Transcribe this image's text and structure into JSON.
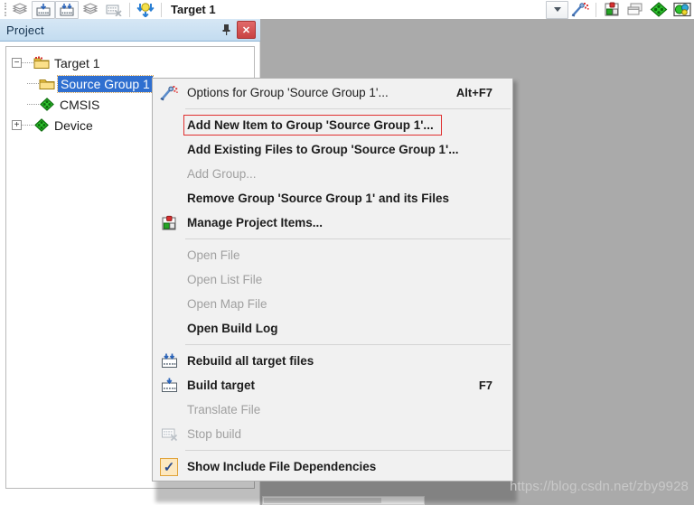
{
  "toolbar": {
    "icons": [
      {
        "name": "batch-build-icon",
        "glyph": "books"
      },
      {
        "name": "build-target-icon",
        "glyph": "build"
      },
      {
        "name": "rebuild-all-icon",
        "glyph": "rebuild"
      },
      {
        "name": "batch-setup-icon",
        "glyph": "books2"
      },
      {
        "name": "stop-build-icon",
        "glyph": "stopbuild"
      },
      {
        "name": "download-flash-icon",
        "glyph": "flash"
      }
    ],
    "target_label": "Target 1",
    "dropdown_arrow_name": "target-dropdown-arrow",
    "right_icons": [
      {
        "name": "target-options-icon",
        "glyph": "wand"
      },
      {
        "name": "manage-project-items-icon",
        "glyph": "cubes"
      },
      {
        "name": "multi-project-icon",
        "glyph": "windows"
      },
      {
        "name": "pack-installer-icon",
        "glyph": "greendiamond"
      },
      {
        "name": "manage-run-time-env-icon",
        "glyph": "globe"
      }
    ]
  },
  "project_panel": {
    "title": "Project",
    "pin_icon_name": "auto-hide-pin-icon",
    "close_label": "✕",
    "tree": [
      {
        "label": "Target 1",
        "icon": "target-folder-icon",
        "expander": "−",
        "level": 0,
        "selected": false
      },
      {
        "label": "Source Group 1",
        "icon": "folder-icon",
        "expander": "",
        "level": 1,
        "selected": true
      },
      {
        "label": "CMSIS",
        "icon": "component-icon",
        "expander": "",
        "level": 1,
        "selected": false
      },
      {
        "label": "Device",
        "icon": "component-icon",
        "expander": "+",
        "level": 1,
        "selected": false
      }
    ]
  },
  "context_menu": {
    "items": [
      {
        "kind": "item",
        "label": "Options for Group 'Source Group 1'...",
        "accel": "Alt+F7",
        "icon": "options-wand-icon",
        "disabled": false,
        "bold": false,
        "highlighted": false
      },
      {
        "kind": "separator"
      },
      {
        "kind": "item",
        "label": "Add New  Item to Group 'Source Group 1'...",
        "accel": "",
        "icon": "",
        "disabled": false,
        "bold": true,
        "highlighted": true
      },
      {
        "kind": "item",
        "label": "Add Existing Files to Group 'Source Group 1'...",
        "accel": "",
        "icon": "",
        "disabled": false,
        "bold": true,
        "highlighted": false
      },
      {
        "kind": "item",
        "label": "Add Group...",
        "accel": "",
        "icon": "",
        "disabled": true,
        "bold": false,
        "highlighted": false
      },
      {
        "kind": "item",
        "label": "Remove Group 'Source Group 1' and its Files",
        "accel": "",
        "icon": "",
        "disabled": false,
        "bold": true,
        "highlighted": false
      },
      {
        "kind": "item",
        "label": "Manage Project Items...",
        "accel": "",
        "icon": "manage-project-items-icon",
        "disabled": false,
        "bold": true,
        "highlighted": false
      },
      {
        "kind": "separator"
      },
      {
        "kind": "item",
        "label": "Open File",
        "accel": "",
        "icon": "",
        "disabled": true,
        "bold": false,
        "highlighted": false
      },
      {
        "kind": "item",
        "label": "Open List File",
        "accel": "",
        "icon": "",
        "disabled": true,
        "bold": false,
        "highlighted": false
      },
      {
        "kind": "item",
        "label": "Open Map File",
        "accel": "",
        "icon": "",
        "disabled": true,
        "bold": false,
        "highlighted": false
      },
      {
        "kind": "item",
        "label": "Open Build Log",
        "accel": "",
        "icon": "",
        "disabled": false,
        "bold": true,
        "highlighted": false
      },
      {
        "kind": "separator"
      },
      {
        "kind": "item",
        "label": "Rebuild all target files",
        "accel": "",
        "icon": "rebuild-all-icon",
        "disabled": false,
        "bold": true,
        "highlighted": false
      },
      {
        "kind": "item",
        "label": "Build target",
        "accel": "F7",
        "icon": "build-target-icon",
        "disabled": false,
        "bold": true,
        "highlighted": false
      },
      {
        "kind": "item",
        "label": "Translate File",
        "accel": "",
        "icon": "",
        "disabled": true,
        "bold": false,
        "highlighted": false
      },
      {
        "kind": "item",
        "label": "Stop build",
        "accel": "",
        "icon": "stop-build-icon",
        "disabled": true,
        "bold": false,
        "highlighted": false
      },
      {
        "kind": "separator"
      },
      {
        "kind": "checkitem",
        "label": "Show Include File Dependencies",
        "accel": "",
        "icon": "checkbox-checked-icon",
        "checked": true,
        "disabled": false,
        "bold": true,
        "highlighted": false
      }
    ]
  },
  "watermark": {
    "text": "https://blog.csdn.net/zby9928"
  },
  "colors": {
    "selection_blue": "#2f6fd0",
    "titlebar_blue": "#c3dcf0",
    "menu_bg": "#f1f1f1",
    "highlight_red": "#e03030",
    "workspace_gray": "#aaaaaa"
  }
}
